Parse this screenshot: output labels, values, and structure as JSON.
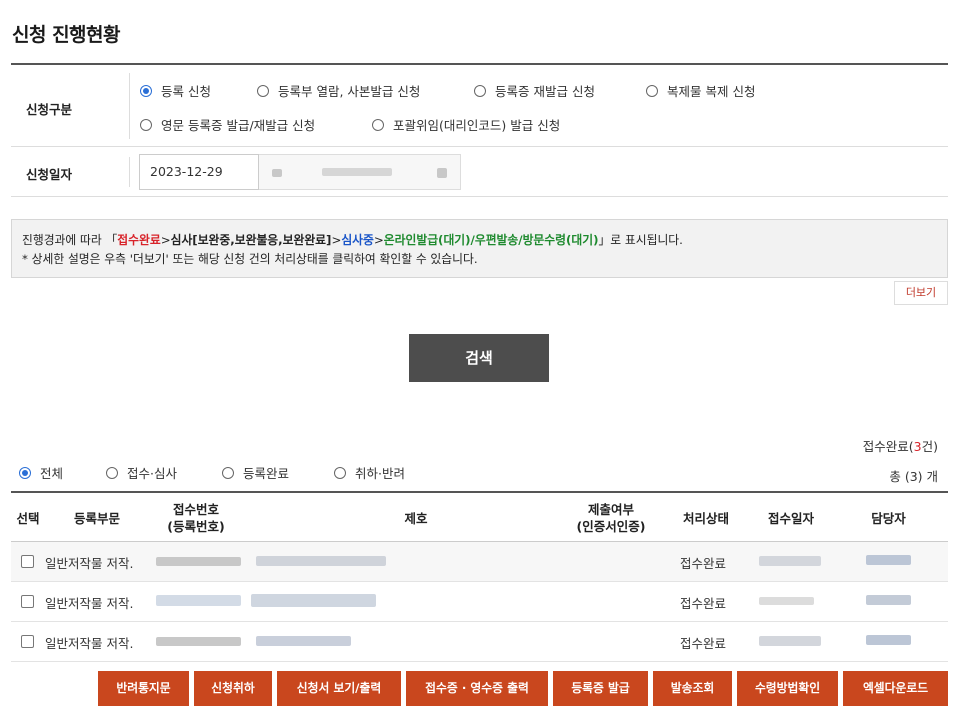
{
  "page": {
    "title": "신청 진행현황"
  },
  "form": {
    "type_label": "신청구분",
    "type_options": [
      {
        "label": "등록 신청",
        "selected": true
      },
      {
        "label": "등록부 열람, 사본발급 신청",
        "selected": false
      },
      {
        "label": "등록증 재발급 신청",
        "selected": false
      },
      {
        "label": "복제물 복제 신청",
        "selected": false
      },
      {
        "label": "영문 등록증 발급/재발급 신청",
        "selected": false
      },
      {
        "label": "포괄위임(대리인코드) 발급 신청",
        "selected": false
      }
    ],
    "date_label": "신청일자",
    "date_start": "2023-12-29"
  },
  "notice": {
    "line1_prefix": "진행경과에 따라 「",
    "stage1": "접수완료",
    "sep1": ">",
    "stage2": "심사[보완중,보완불응,보완완료]",
    "sep2": ">",
    "stage3": "심사중",
    "sep3": ">",
    "stage4": "온라인발급(대기)/우편발송/방문수령(대기)",
    "line1_suffix": "」로 표시됩니다.",
    "line2": "* 상세한 설명은 우측 '더보기' 또는 해당 신청 건의 처리상태를 클릭하여 확인할 수 있습니다.",
    "more_label": "더보기"
  },
  "search": {
    "button_label": "검색"
  },
  "summary": {
    "prefix": "접수완료(",
    "count": "3",
    "suffix": "건)",
    "total": "총 (3) 개"
  },
  "filters": [
    {
      "label": "전체",
      "selected": true
    },
    {
      "label": "접수·심사",
      "selected": false
    },
    {
      "label": "등록완료",
      "selected": false
    },
    {
      "label": "취하·반려",
      "selected": false
    }
  ],
  "table": {
    "headers": {
      "select": "선택",
      "department": "등록부문",
      "receipt_no_1": "접수번호",
      "receipt_no_2": "(등록번호)",
      "title": "제호",
      "submit_1": "제출여부",
      "submit_2": "(인증서인증)",
      "status": "처리상태",
      "date": "접수일자",
      "manager": "담당자"
    },
    "rows": [
      {
        "department": "일반저작물 저작.",
        "status": "접수완료"
      },
      {
        "department": "일반저작물 저작.",
        "status": "접수완료"
      },
      {
        "department": "일반저작물 저작.",
        "status": "접수완료"
      }
    ]
  },
  "actions": [
    "반려통지문",
    "신청취하",
    "신청서 보기/출력",
    "접수증 · 영수증 출력",
    "등록증 발급",
    "발송조회",
    "수령방법확인",
    "엑셀다운로드"
  ],
  "colors": {
    "accent_button": "#c9471e",
    "search_button": "#4d4d4d",
    "radio_selected": "#2b6fd6",
    "stage_red": "#d8232a",
    "stage_blue": "#1a55c8",
    "stage_green": "#1e8a2e"
  }
}
